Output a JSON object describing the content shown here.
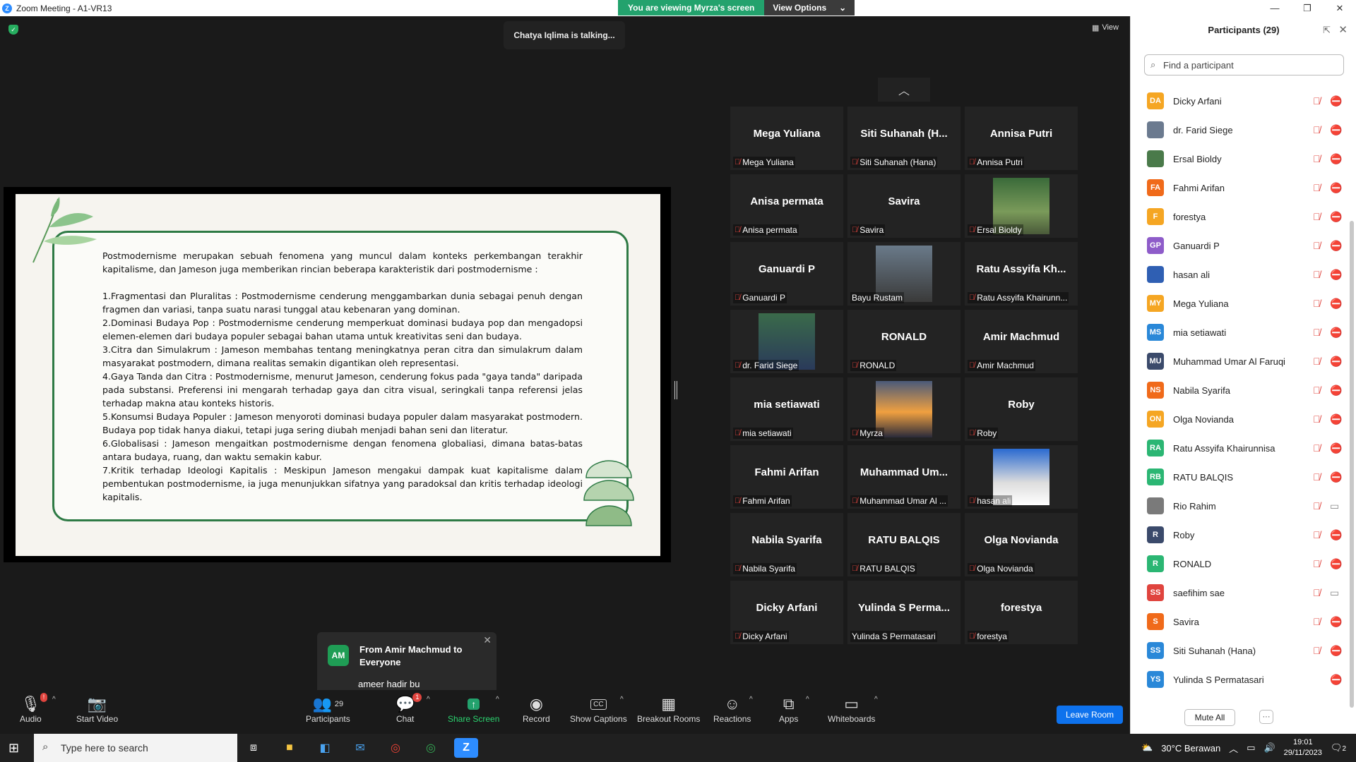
{
  "window": {
    "title": "Zoom Meeting - A1-VR13",
    "logo_letter": "Z"
  },
  "banner": {
    "viewing": "You are viewing Myrza's screen",
    "view_options": "View Options"
  },
  "meeting": {
    "talking": "Chatya Iqlima is talking...",
    "view_label": "View"
  },
  "slide": {
    "intro": "Postmodernisme merupakan sebuah fenomena yang muncul dalam konteks perkembangan terakhir kapitalisme, dan Jameson juga memberikan rincian beberapa karakteristik dari postmodernisme :",
    "points": [
      "1.Fragmentasi dan Pluralitas : Postmodernisme cenderung menggambarkan dunia sebagai penuh dengan fragmen dan variasi, tanpa suatu narasi tunggal atau kebenaran yang dominan.",
      "2.Dominasi Budaya Pop : Postmodernisme cenderung memperkuat dominasi budaya pop dan mengadopsi elemen-elemen dari budaya populer sebagai bahan utama untuk kreativitas seni dan budaya.",
      "3.Citra dan Simulakrum : Jameson membahas tentang meningkatnya peran citra dan simulakrum dalam masyarakat postmodern, dimana realitas semakin digantikan oleh representasi.",
      "4.Gaya Tanda dan Citra : Postmodernisme, menurut Jameson, cenderung fokus pada \"gaya tanda\" daripada pada substansi. Preferensi ini mengarah terhadap gaya dan citra visual, seringkali tanpa referensi jelas terhadap makna atau konteks historis.",
      "5.Konsumsi Budaya Populer : Jameson menyoroti dominasi budaya populer dalam masyarakat postmodern. Budaya pop tidak hanya diakui, tetapi juga sering diubah menjadi bahan seni dan literatur.",
      "6.Globalisasi : Jameson mengaitkan postmodernisme dengan fenomena globaliasi, dimana batas-batas antara budaya, ruang, dan waktu semakin kabur.",
      "7.Kritik terhadap Ideologi Kapitalis : Meskipun Jameson mengakui dampak kuat kapitalisme dalam pembentukan postmodernisme, ia juga menunjukkan sifatnya yang paradoksal dan kritis terhadap ideologi kapitalis."
    ]
  },
  "tiles": [
    {
      "name": "Mega Yuliana",
      "label": "Mega Yuliana",
      "muted": true,
      "photo": ""
    },
    {
      "name": "Siti Suhanah (H...",
      "label": "Siti Suhanah (Hana)",
      "muted": true,
      "photo": ""
    },
    {
      "name": "Annisa Putri",
      "label": "Annisa Putri",
      "muted": true,
      "photo": ""
    },
    {
      "name": "Anisa permata",
      "label": "Anisa permata",
      "muted": true,
      "photo": ""
    },
    {
      "name": "Savira",
      "label": "Savira",
      "muted": true,
      "photo": ""
    },
    {
      "name": "",
      "label": "Ersal Bioldy",
      "muted": true,
      "photo": "forest"
    },
    {
      "name": "Ganuardi P",
      "label": "Ganuardi P",
      "muted": true,
      "photo": ""
    },
    {
      "name": "",
      "label": "Bayu Rustam",
      "muted": false,
      "photo": "man"
    },
    {
      "name": "Ratu Assyifa Kh...",
      "label": "Ratu Assyifa Khairunn...",
      "muted": true,
      "photo": ""
    },
    {
      "name": "",
      "label": "dr. Farid Siege",
      "muted": true,
      "photo": "man2"
    },
    {
      "name": "RONALD",
      "label": "RONALD",
      "muted": true,
      "photo": ""
    },
    {
      "name": "Amir Machmud",
      "label": "Amir Machmud",
      "muted": true,
      "photo": ""
    },
    {
      "name": "mia setiawati",
      "label": "mia setiawati",
      "muted": true,
      "photo": ""
    },
    {
      "name": "",
      "label": "Myrza",
      "muted": true,
      "photo": "sunset"
    },
    {
      "name": "Roby",
      "label": "Roby",
      "muted": true,
      "photo": ""
    },
    {
      "name": "Fahmi Arifan",
      "label": "Fahmi Arifan",
      "muted": true,
      "photo": ""
    },
    {
      "name": "Muhammad Um...",
      "label": "Muhammad Umar Al ...",
      "muted": true,
      "photo": ""
    },
    {
      "name": "",
      "label": "hasan ali",
      "muted": true,
      "photo": "portrait"
    },
    {
      "name": "Nabila Syarifa",
      "label": "Nabila Syarifa",
      "muted": true,
      "photo": ""
    },
    {
      "name": "RATU BALQIS",
      "label": "RATU BALQIS",
      "muted": true,
      "photo": ""
    },
    {
      "name": "Olga Novianda",
      "label": "Olga Novianda",
      "muted": true,
      "photo": ""
    },
    {
      "name": "Dicky Arfani",
      "label": "Dicky Arfani",
      "muted": true,
      "photo": ""
    },
    {
      "name": "Yulinda S Perma...",
      "label": "Yulinda S Permatasari",
      "muted": false,
      "photo": ""
    },
    {
      "name": "forestya",
      "label": "forestya",
      "muted": true,
      "photo": ""
    }
  ],
  "chat_popup": {
    "initials": "AM",
    "from": "From Amir Machmud to Everyone",
    "message": "ameer hadir bu"
  },
  "toolbar": {
    "audio": "Audio",
    "audio_badge": "!",
    "video": "Start Video",
    "participants": "Participants",
    "participants_count": "29",
    "chat": "Chat",
    "chat_badge": "1",
    "share": "Share Screen",
    "record": "Record",
    "captions": "Show Captions",
    "breakout": "Breakout Rooms",
    "reactions": "Reactions",
    "apps": "Apps",
    "whiteboards": "Whiteboards",
    "leave": "Leave Room"
  },
  "panel": {
    "title": "Participants (29)",
    "search_placeholder": "Find a participant",
    "mute_all": "Mute All",
    "more": "···",
    "participants": [
      {
        "initials": "DA",
        "name": "Dicky Arfani",
        "color": "#f5a623",
        "mic_muted": true,
        "video_off": true
      },
      {
        "initials": "",
        "name": "dr. Farid Siege",
        "color": "#6b7a8f",
        "mic_muted": true,
        "video_off": true
      },
      {
        "initials": "",
        "name": "Ersal Bioldy",
        "color": "#4a7a4a",
        "mic_muted": true,
        "video_off": true
      },
      {
        "initials": "FA",
        "name": "Fahmi Arifan",
        "color": "#f06a1a",
        "mic_muted": true,
        "video_off": true
      },
      {
        "initials": "F",
        "name": "forestya",
        "color": "#f5a623",
        "mic_muted": true,
        "video_off": true
      },
      {
        "initials": "GP",
        "name": "Ganuardi P",
        "color": "#8e5cc9",
        "mic_muted": true,
        "video_off": true
      },
      {
        "initials": "",
        "name": "hasan ali",
        "color": "#2f5fb3",
        "mic_muted": true,
        "video_off": true
      },
      {
        "initials": "MY",
        "name": "Mega Yuliana",
        "color": "#f5a623",
        "mic_muted": true,
        "video_off": true
      },
      {
        "initials": "MS",
        "name": "mia setiawati",
        "color": "#2a88d8",
        "mic_muted": true,
        "video_off": true
      },
      {
        "initials": "MU",
        "name": "Muhammad Umar Al Faruqi",
        "color": "#3b4a6b",
        "mic_muted": true,
        "video_off": true
      },
      {
        "initials": "NS",
        "name": "Nabila Syarifa",
        "color": "#f06a1a",
        "mic_muted": true,
        "video_off": true
      },
      {
        "initials": "ON",
        "name": "Olga Novianda",
        "color": "#f5a623",
        "mic_muted": true,
        "video_off": true
      },
      {
        "initials": "RA",
        "name": "Ratu Assyifa Khairunnisa",
        "color": "#2bb673",
        "mic_muted": true,
        "video_off": true
      },
      {
        "initials": "RB",
        "name": "RATU BALQIS",
        "color": "#2bb673",
        "mic_muted": true,
        "video_off": true
      },
      {
        "initials": "",
        "name": "Rio Rahim",
        "color": "#7a7a7a",
        "mic_muted": true,
        "video_off": false
      },
      {
        "initials": "R",
        "name": "Roby",
        "color": "#3b4a6b",
        "mic_muted": true,
        "video_off": true
      },
      {
        "initials": "R",
        "name": "RONALD",
        "color": "#2bb673",
        "mic_muted": true,
        "video_off": true
      },
      {
        "initials": "SS",
        "name": "saefihim sae",
        "color": "#e0443e",
        "mic_muted": true,
        "video_off": false
      },
      {
        "initials": "S",
        "name": "Savira",
        "color": "#f06a1a",
        "mic_muted": true,
        "video_off": true
      },
      {
        "initials": "SS",
        "name": "Siti Suhanah (Hana)",
        "color": "#2a88d8",
        "mic_muted": true,
        "video_off": true
      },
      {
        "initials": "YS",
        "name": "Yulinda S Permatasari",
        "color": "#2a88d8",
        "mic_muted": false,
        "video_off": true
      }
    ]
  },
  "taskbar": {
    "search_placeholder": "Type here to search",
    "weather": "30°C Berawan",
    "time": "19:01",
    "date": "29/11/2023",
    "notifications": "2"
  }
}
